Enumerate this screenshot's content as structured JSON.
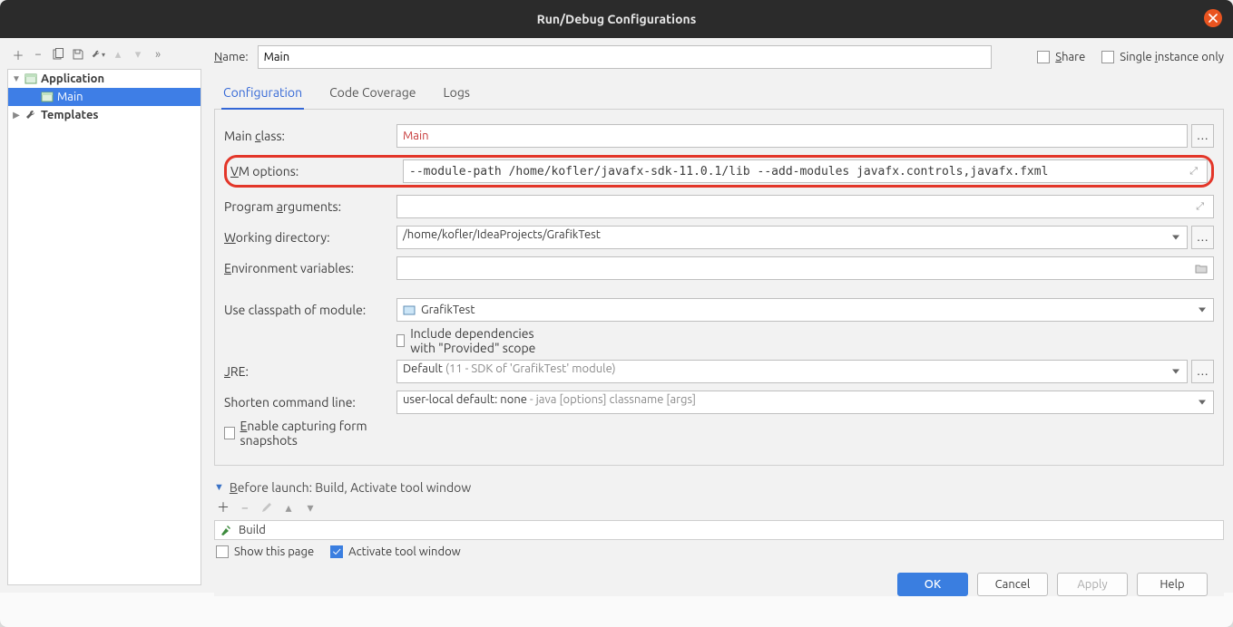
{
  "window": {
    "title": "Run/Debug Configurations"
  },
  "topRight": {
    "share": "Share",
    "single_instance": "Single instance only"
  },
  "tree": {
    "items": [
      {
        "label": "Application",
        "bold": true
      },
      {
        "label": "Main",
        "selected": true
      },
      {
        "label": "Templates",
        "bold": true
      }
    ]
  },
  "name": {
    "label": "Name:",
    "value": "Main"
  },
  "tabs": [
    "Configuration",
    "Code Coverage",
    "Logs"
  ],
  "form": {
    "main_class_label": "Main class:",
    "main_class_value": "Main",
    "vm_options_label": "VM options:",
    "vm_options_value": "--module-path /home/kofler/javafx-sdk-11.0.1/lib --add-modules javafx.controls,javafx.fxml",
    "program_args_label": "Program arguments:",
    "program_args_value": "",
    "working_dir_label": "Working directory:",
    "working_dir_value": "/home/kofler/IdeaProjects/GrafikTest",
    "env_vars_label": "Environment variables:",
    "env_vars_value": "",
    "classpath_label": "Use classpath of module:",
    "classpath_value": "GrafikTest",
    "include_provided": "Include dependencies with \"Provided\" scope",
    "jre_label": "JRE:",
    "jre_value_prefix": "Default ",
    "jre_value_grey": "(11 - SDK of 'GrafikTest' module)",
    "shorten_label": "Shorten command line:",
    "shorten_value_prefix": "user-local default: none ",
    "shorten_value_grey": "- java [options] classname [args]",
    "enable_snapshots": "Enable capturing form snapshots"
  },
  "before_launch": {
    "header": "Before launch: Build, Activate tool window",
    "build": "Build",
    "show_this_page": "Show this page",
    "activate_tool_window": "Activate tool window"
  },
  "buttons": {
    "ok": "OK",
    "cancel": "Cancel",
    "apply": "Apply",
    "help": "Help"
  }
}
